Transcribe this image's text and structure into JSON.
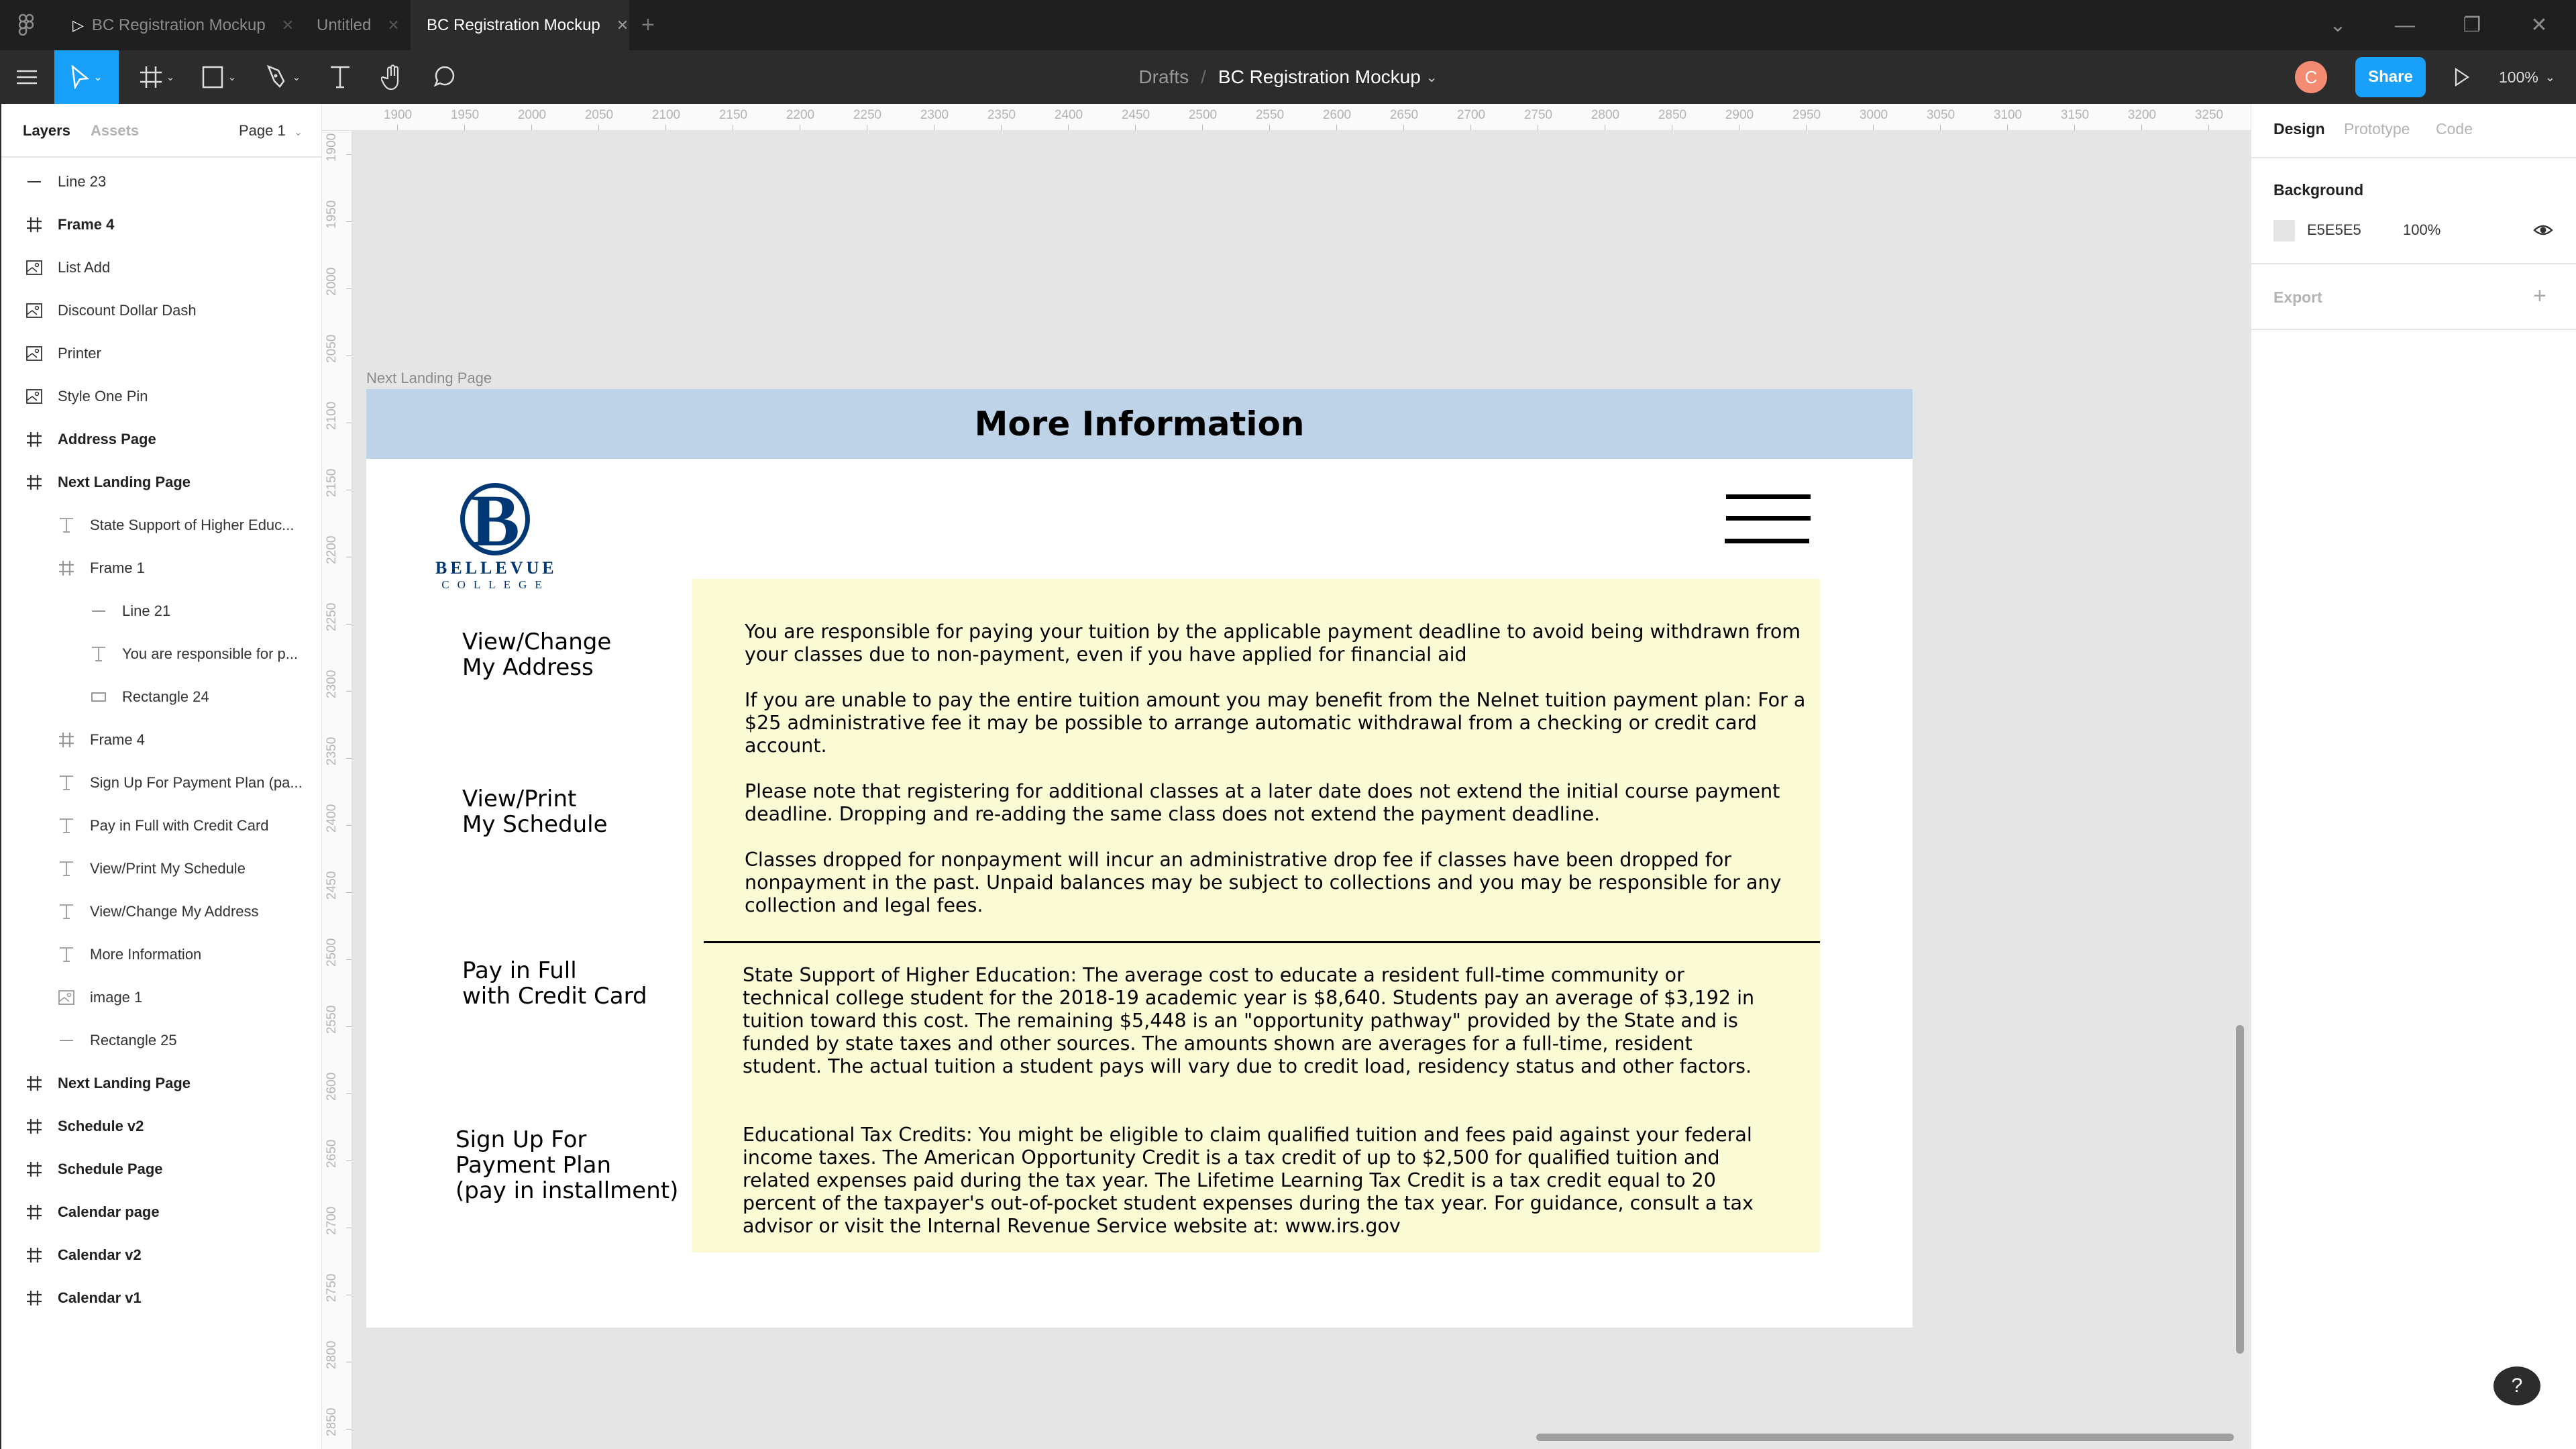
{
  "tabs": [
    {
      "label": "BC Registration Mockup",
      "icon": "play-icon",
      "active": false
    },
    {
      "label": "Untitled",
      "active": false
    },
    {
      "label": "BC Registration Mockup",
      "active": true
    }
  ],
  "new_tab_label": "+",
  "window_controls": {
    "dropdown": "⌄",
    "minimize": "—",
    "restore": "❐",
    "close": "✕"
  },
  "toolbar": {
    "breadcrumb": {
      "parent": "Drafts",
      "separator": "/",
      "current": "BC Registration Mockup",
      "caret": "⌄"
    },
    "avatar_initial": "C",
    "share_label": "Share",
    "zoom_level": "100%"
  },
  "layers_panel": {
    "tabs": {
      "layers": "Layers",
      "assets": "Assets"
    },
    "page_selector": "Page 1",
    "items": [
      {
        "label": "Line 23",
        "icon": "line-icon",
        "depth": 0,
        "bold": false
      },
      {
        "label": "Frame 4",
        "icon": "frame-icon",
        "depth": 0,
        "bold": true
      },
      {
        "label": "List Add",
        "icon": "image-icon",
        "depth": 0,
        "bold": false
      },
      {
        "label": "Discount Dollar Dash",
        "icon": "image-icon",
        "depth": 0,
        "bold": false
      },
      {
        "label": "Printer",
        "icon": "image-icon",
        "depth": 0,
        "bold": false
      },
      {
        "label": "Style One Pin",
        "icon": "image-icon",
        "depth": 0,
        "bold": false
      },
      {
        "label": "Address Page",
        "icon": "frame-icon",
        "depth": 0,
        "bold": true
      },
      {
        "label": "Next Landing Page",
        "icon": "frame-icon",
        "depth": 0,
        "bold": true
      },
      {
        "label": "State Support of Higher Educ...",
        "icon": "text-icon",
        "depth": 1,
        "bold": false
      },
      {
        "label": "Frame 1",
        "icon": "frame-icon",
        "depth": 1,
        "bold": false
      },
      {
        "label": "Line 21",
        "icon": "line-icon",
        "depth": 2,
        "bold": false
      },
      {
        "label": "You are responsible for p...",
        "icon": "text-icon",
        "depth": 2,
        "bold": false
      },
      {
        "label": "Rectangle 24",
        "icon": "rectangle-icon",
        "depth": 2,
        "bold": false
      },
      {
        "label": "Frame 4",
        "icon": "frame-icon",
        "depth": 1,
        "bold": false
      },
      {
        "label": "Sign Up For Payment Plan (pa...",
        "icon": "text-icon",
        "depth": 1,
        "bold": false
      },
      {
        "label": "Pay in Full with Credit Card",
        "icon": "text-icon",
        "depth": 1,
        "bold": false
      },
      {
        "label": "View/Print My Schedule",
        "icon": "text-icon",
        "depth": 1,
        "bold": false
      },
      {
        "label": "View/Change My Address",
        "icon": "text-icon",
        "depth": 1,
        "bold": false
      },
      {
        "label": "More Information",
        "icon": "text-icon",
        "depth": 1,
        "bold": false
      },
      {
        "label": "image 1",
        "icon": "image-icon",
        "depth": 1,
        "bold": false
      },
      {
        "label": "Rectangle 25",
        "icon": "line-icon",
        "depth": 1,
        "bold": false
      },
      {
        "label": "Next Landing Page",
        "icon": "frame-icon",
        "depth": 0,
        "bold": true
      },
      {
        "label": "Schedule v2",
        "icon": "frame-icon",
        "depth": 0,
        "bold": true
      },
      {
        "label": "Schedule Page",
        "icon": "frame-icon",
        "depth": 0,
        "bold": true
      },
      {
        "label": "Calendar page",
        "icon": "frame-icon",
        "depth": 0,
        "bold": true
      },
      {
        "label": "Calendar v2",
        "icon": "frame-icon",
        "depth": 0,
        "bold": true
      },
      {
        "label": "Calendar v1",
        "icon": "frame-icon",
        "depth": 0,
        "bold": true
      }
    ]
  },
  "rulers": {
    "horizontal": [
      "1900",
      "1950",
      "2000",
      "2050",
      "2100",
      "2150",
      "2200",
      "2250",
      "2300",
      "2350",
      "2400",
      "2450",
      "2500",
      "2550",
      "2600",
      "2650",
      "2700",
      "2750",
      "2800",
      "2850",
      "2900",
      "2950",
      "3000",
      "3050",
      "3100",
      "3150",
      "3200",
      "3250"
    ],
    "vertical": [
      "1900",
      "1950",
      "2000",
      "2050",
      "2100",
      "2150",
      "2200",
      "2250",
      "2300",
      "2350",
      "2400",
      "2450",
      "2500",
      "2550",
      "2600",
      "2650",
      "2700",
      "2750",
      "2800",
      "2850"
    ]
  },
  "canvas": {
    "frame_label": "Next Landing Page",
    "mockup": {
      "title": "More Information",
      "logo": {
        "letter": "B",
        "name": "BELLEVUE",
        "sub": "COLLEGE"
      },
      "nav_links": [
        "View/Change\nMy Address",
        "View/Print\nMy Schedule",
        "Pay in Full\nwith Credit Card",
        "Sign Up For\nPayment Plan\n(pay in installment)"
      ],
      "paragraphs_top": [
        "You are responsible for paying your tuition by the applicable payment deadline to avoid being withdrawn from your classes due to non-payment, even if you have applied for financial aid",
        "If you are unable to pay the entire tuition amount you may benefit from the Nelnet tuition payment plan: For a $25 administrative fee it may be possible to arrange automatic withdrawal from a checking or credit card account.",
        "Please note that registering for additional classes at a later date does not extend the initial course payment deadline. Dropping and re-adding the same class does not extend the payment deadline.",
        "Classes dropped for nonpayment will incur an administrative drop fee if classes have been dropped for nonpayment in the past. Unpaid balances may be subject to collections and you may be responsible for any collection and legal fees."
      ],
      "paragraphs_bottom": [
        "State Support of Higher Education: The average cost to educate a resident full-time community or technical college student for the 2018-19 academic year is $8,640. Students pay an average of $3,192 in tuition toward this cost. The remaining $5,448 is an \"opportunity pathway\" provided by the State and is funded by state taxes and other sources. The amounts shown are averages for a full-time, resident student. The actual tuition a student pays will vary due to credit load, residency status and other factors.",
        "Educational Tax Credits: You might be eligible to claim qualified tuition and fees paid against your federal income taxes. The American Opportunity Credit is a tax credit of up to $2,500 for qualified tuition and related expenses paid during the tax year. The Lifetime Learning Tax Credit is a tax credit equal to 20 percent of the taxpayer's out-of-pocket student expenses during the tax year. For guidance, consult a tax advisor or visit the Internal Revenue Service website at: www.irs.gov"
      ],
      "colors": {
        "header_bg": "#BED3E7",
        "info_bg": "#FAFAD4",
        "logo_blue": "#003876"
      }
    }
  },
  "design_panel": {
    "tabs": {
      "design": "Design",
      "prototype": "Prototype",
      "code": "Code"
    },
    "background_label": "Background",
    "background_hex": "E5E5E5",
    "background_opacity": "100%",
    "export_label": "Export",
    "export_add": "+"
  },
  "help_label": "?",
  "accent_color": "#18A0FB"
}
